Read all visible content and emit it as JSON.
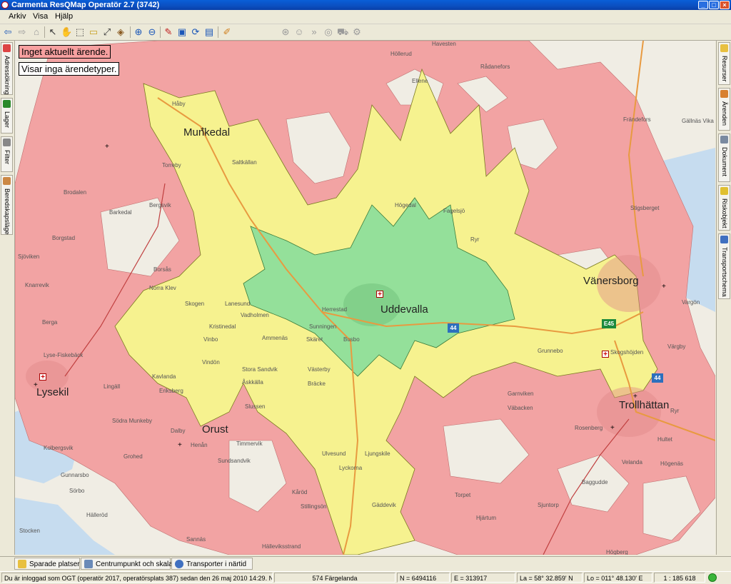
{
  "window": {
    "title": "Carmenta ResQMap Operatör 2.7 (3742)",
    "btn_min": "_",
    "btn_max": "□",
    "btn_close": "×"
  },
  "menu": {
    "items": [
      "Arkiv",
      "Visa",
      "Hjälp"
    ]
  },
  "toolbar": {
    "icons": [
      "back-arrow-icon",
      "forward-arrow-icon",
      "home-icon",
      "pointer-icon",
      "pan-hand-icon",
      "zoom-rect-icon",
      "measure-ruler-icon",
      "scale-icon",
      "select-object-icon",
      "zoom-in-icon",
      "zoom-out-icon",
      "draw-pencil-icon",
      "map-view-icon",
      "map-refresh-icon",
      "map-layers-icon",
      "eraser-icon",
      "gps-target-icon",
      "person-icon",
      "chain-icon",
      "sound-icon",
      "vehicle-icon",
      "settings-icon"
    ]
  },
  "left_tabs": [
    {
      "label": "Adressökning",
      "color": "#d44"
    },
    {
      "label": "Lager",
      "color": "#2a8a2a"
    },
    {
      "label": "Filter",
      "color": "#888"
    },
    {
      "label": "Beredskapsläge",
      "color": "#c84"
    }
  ],
  "right_tabs": [
    {
      "label": "Resurser",
      "color": "#e8c040"
    },
    {
      "label": "Ärenden",
      "color": "#d88030"
    },
    {
      "label": "Dokument",
      "color": "#7a8aa0"
    },
    {
      "label": "Riskobjekt",
      "color": "#e0c030"
    },
    {
      "label": "Transportschema",
      "color": "#4070c0"
    }
  ],
  "messages": {
    "no_case": "Inget aktuellt ärende.",
    "no_types": "Visar inga ärendetyper."
  },
  "map": {
    "colors": {
      "red_zone": "#f2a3a3",
      "yellow_zone": "#f6f28f",
      "green_zone": "#94e09a",
      "water": "#c6dcef",
      "land": "#f0ede4"
    },
    "cities": {
      "munkedal": "Munkedal",
      "uddevalla": "Uddevalla",
      "vanersborg": "Vänersborg",
      "trollhattan": "Trollhättan",
      "lysekil": "Lysekil",
      "orust": "Orust"
    },
    "places": {
      "havesten": "Havesten",
      "hollerud": "Höllerud",
      "radanefors": "Rådanefors",
      "haby": "Håby",
      "ellene": "Ellene",
      "frandefors": "Frändefors",
      "gallnas": "Gällnäs Vika",
      "torreby": "Torreby",
      "brodalen": "Brodalen",
      "barkedal": "Barkedal",
      "bergsvik": "Bergsvik",
      "saltkallan": "Saltkällan",
      "stigsberget": "Stigsberget",
      "fagelsjo": "Fagelsjö",
      "hogedal": "Högedal",
      "ryr": "Ryr",
      "borgstad": "Borgstad",
      "sjoviken": "Sjöviken",
      "knarrevik": "Knarrevik",
      "borsas": "Borsås",
      "norra_klev": "Norra Klev",
      "skogen": "Skogen",
      "lanesund": "Lanesund",
      "vadholmen": "Vadholmen",
      "herrestad": "Herrestad",
      "kristinedal": "Kristinedal",
      "ammenas": "Ammenäs",
      "skaret": "Skäret",
      "busbo": "Busbo",
      "grunnebo": "Grunnebo",
      "vargon": "Vargön",
      "skogshöjden": "Skogshöjden",
      "berga": "Berga",
      "lyse_fiskeback": "Lyse-Fiskebäck",
      "kavlanda": "Kavlanda",
      "lingall": "Lingäll",
      "stora_sandvik": "Stora Sandvik",
      "askkalla": "Åskkälla",
      "vasterby": "Västerby",
      "bracke": "Bräcke",
      "garnviken": "Garnviken",
      "vabacken": "Väbacken",
      "slussen": "Slussen",
      "sodra_munkeby": "Södra Munkeby",
      "dalby": "Dalby",
      "henan": "Henån",
      "timmervik": "Timmervik",
      "ulvesund": "Ulvesund",
      "ljungskile": "Ljungskile",
      "lyckorna": "Lyckorna",
      "rosenberg": "Rosenberg",
      "sjuntorp": "Sjuntorp",
      "hjartum": "Hjärtum",
      "gunnarsbo": "Gunnarsbo",
      "karod": "Kåröd",
      "sorbo": "Sörbo",
      "stocken": "Stocken",
      "hogberg": "Högberg",
      "sannas": "Sannäs",
      "vinbo": "Vinbo",
      "stillingson": "Stillingsön",
      "gotaatorp": "Gäddevik",
      "halleviksstrand": "Hälleviksstrand",
      "vanersby": "Värgby",
      "hultet": "Hultet",
      "ryr2": "Ryr",
      "eriksberg": "Eriksberg",
      "kolbergs": "Kolbergsvik",
      "torpet": "Torpet",
      "bagguds": "Baggudde",
      "velanda": "Velanda",
      "hogenas": "Högenäs",
      "grohed": "Grohed",
      "haller": "Hälleröd",
      "sundsandvik": "Sundsandvik",
      "vindon": "Vindön",
      "sunningen": "Sunningen"
    },
    "roads": {
      "r44a": "44",
      "r44b": "44",
      "e45": "E45",
      "r44c": "44"
    }
  },
  "bottom_tabs": [
    {
      "label": "Sparade platser",
      "icon": "saved-places-icon"
    },
    {
      "label": "Centrumpunkt och skala",
      "icon": "center-scale-icon"
    },
    {
      "label": "Transporter i närtid",
      "icon": "info-icon"
    }
  ],
  "status": {
    "login": "Du är inloggad som OGT (operatör 2017, operatörsplats 387) sedan den 26 maj 2010 14:29. Norm",
    "area": "574 Färgelanda",
    "n": "N = 6494116",
    "e": "E = 313917",
    "lat": "La = 58° 32.859' N",
    "lon": "Lo = 011° 48.130' E",
    "scale": "1 : 185 618"
  }
}
